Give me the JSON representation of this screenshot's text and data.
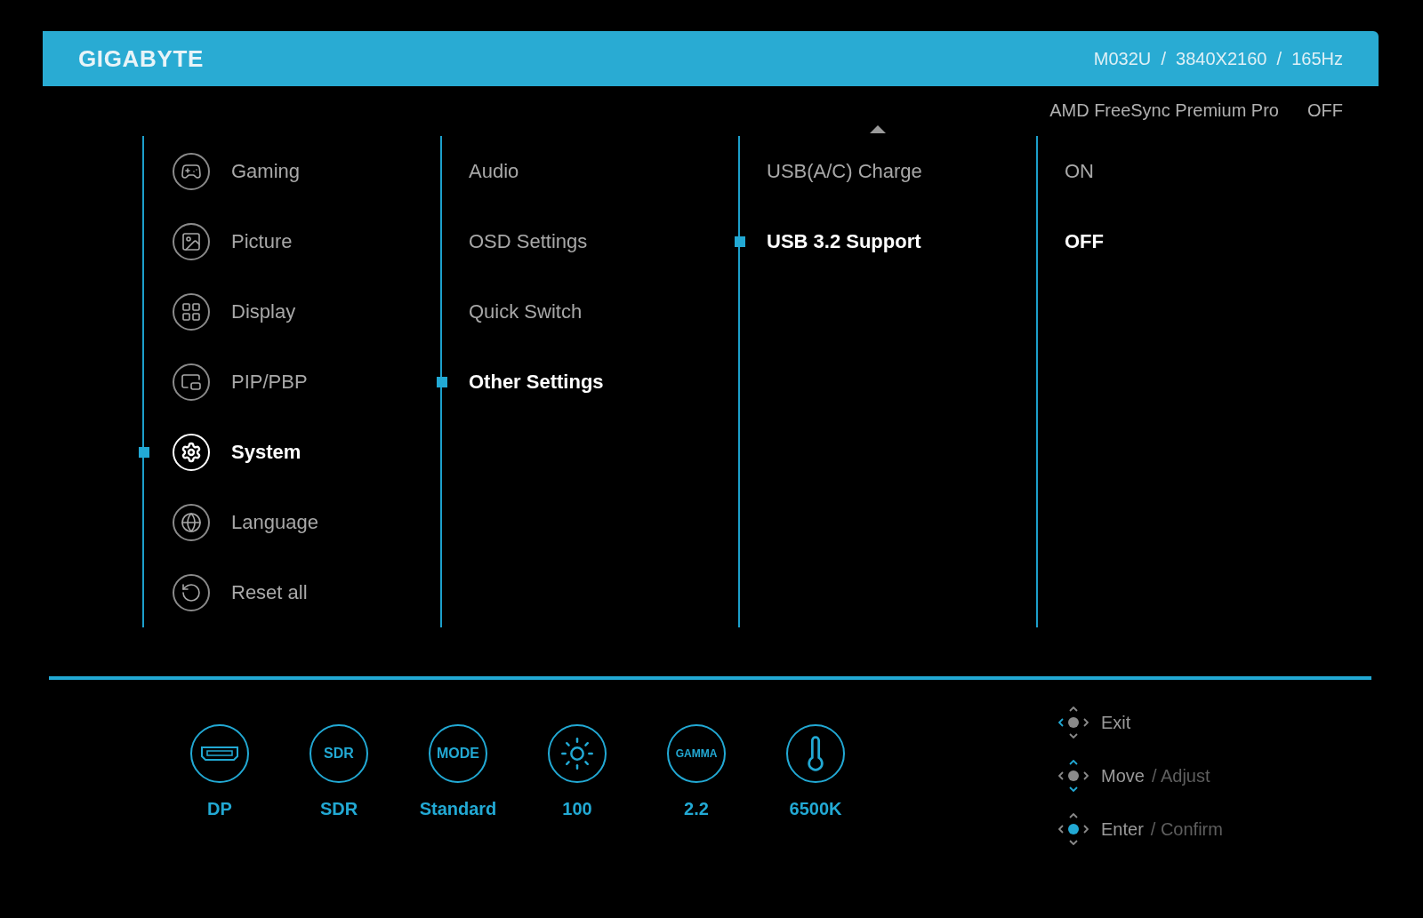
{
  "header": {
    "brand": "GIGABYTE",
    "monitor_info": "M032U  /  3840X2160  /  165Hz"
  },
  "freesync": {
    "label": "AMD FreeSync Premium Pro",
    "value": "OFF"
  },
  "main_menu": [
    {
      "label": "Gaming",
      "kind": "gamepad",
      "selected": false
    },
    {
      "label": "Picture",
      "kind": "picture",
      "selected": false
    },
    {
      "label": "Display",
      "kind": "grid",
      "selected": false
    },
    {
      "label": "PIP/PBP",
      "kind": "pip",
      "selected": false
    },
    {
      "label": "System",
      "kind": "gear",
      "selected": true
    },
    {
      "label": "Language",
      "kind": "globe",
      "selected": false
    },
    {
      "label": "Reset all",
      "kind": "reset",
      "selected": false
    }
  ],
  "sub_menu": [
    {
      "label": "Audio",
      "selected": false
    },
    {
      "label": "OSD Settings",
      "selected": false
    },
    {
      "label": "Quick Switch",
      "selected": false
    },
    {
      "label": "Other Settings",
      "selected": true
    }
  ],
  "options": [
    {
      "label": "USB(A/C) Charge",
      "value": "ON",
      "selected": false
    },
    {
      "label": "USB 3.2 Support",
      "value": "OFF",
      "selected": true
    }
  ],
  "status": [
    {
      "kind": "port",
      "label": "DP"
    },
    {
      "kind": "badge",
      "badge": "SDR",
      "label": "SDR"
    },
    {
      "kind": "badge",
      "badge": "MODE",
      "label": "Standard"
    },
    {
      "kind": "brightness",
      "label": "100"
    },
    {
      "kind": "badge",
      "badge": "GAMMA",
      "label": "2.2"
    },
    {
      "kind": "temperature",
      "label": "6500K"
    }
  ],
  "hints": [
    {
      "kind": "exit",
      "label": "Exit"
    },
    {
      "kind": "move",
      "label": "Move",
      "secondary": "/ Adjust"
    },
    {
      "kind": "enter",
      "label": "Enter",
      "secondary": "/ Confirm"
    }
  ]
}
